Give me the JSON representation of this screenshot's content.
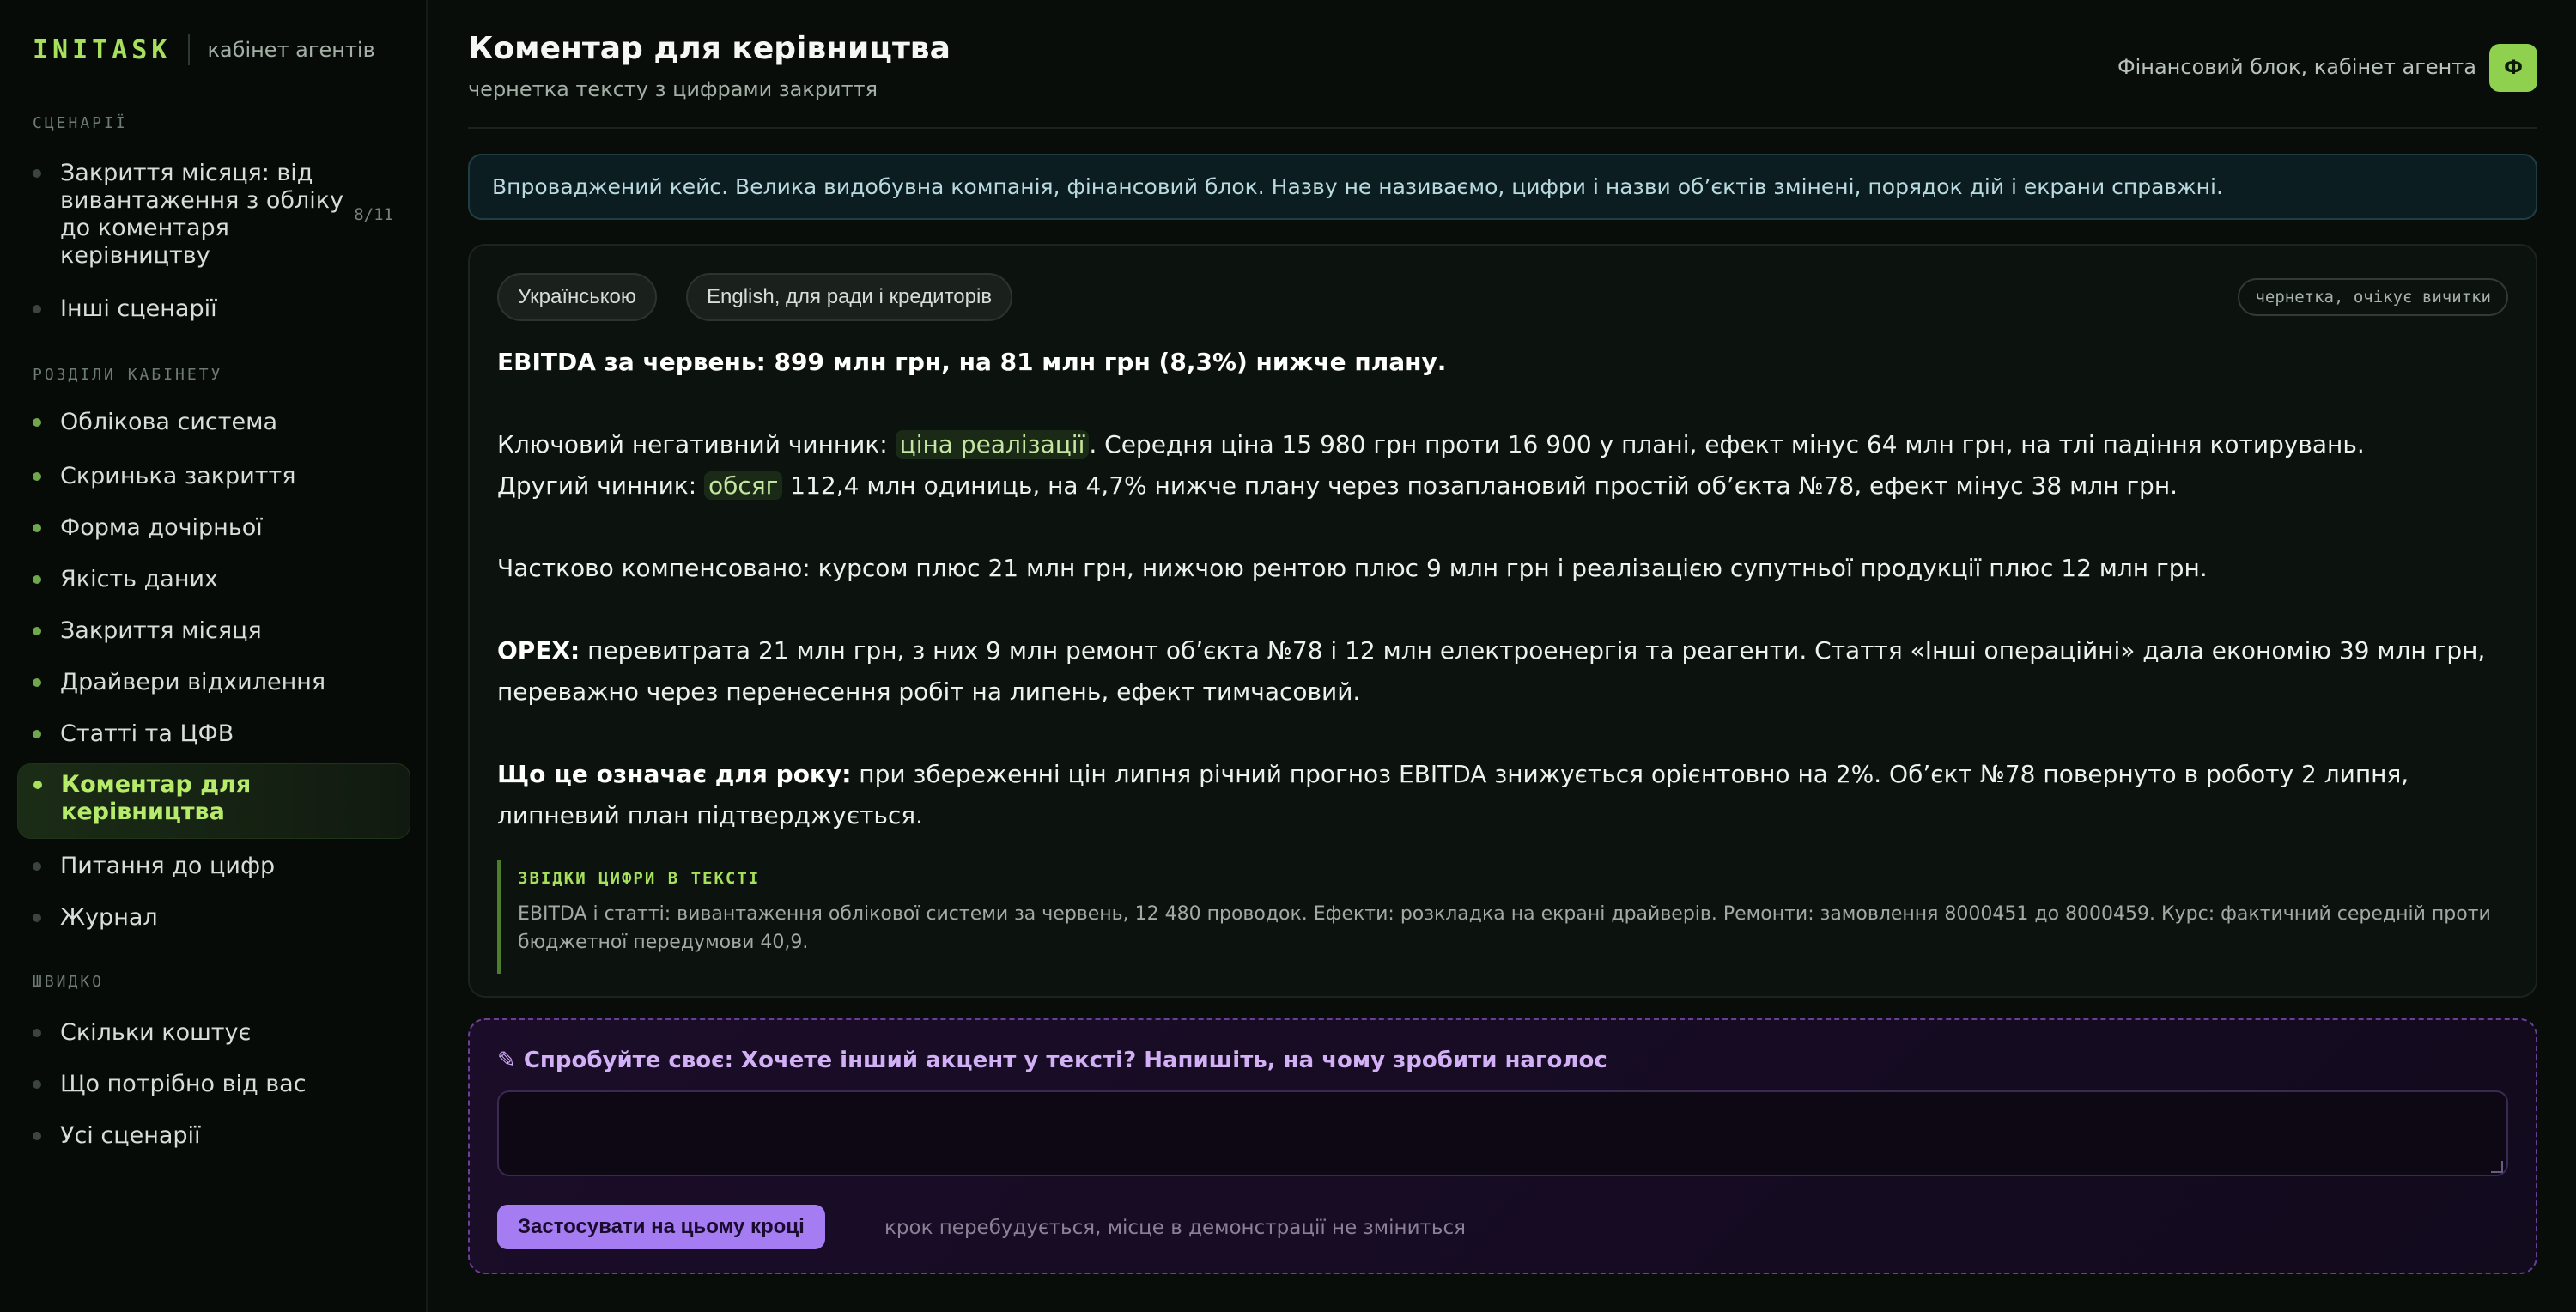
{
  "brand": {
    "logo": "INITASK",
    "subtitle": "кабінет агентів"
  },
  "sidebar": {
    "scenarios_title": "СЦЕНАРІЇ",
    "scenarios": [
      {
        "label": "Закриття місяця: від вивантаження з обліку до коментаря керівництву",
        "count": "8/11"
      },
      {
        "label": "Інші сценарії"
      }
    ],
    "sections_title": "РОЗДІЛИ КАБІНЕТУ",
    "sections": [
      {
        "label": "Облікова система"
      },
      {
        "label": "Скринька закриття"
      },
      {
        "label": "Форма дочірньої"
      },
      {
        "label": "Якість даних"
      },
      {
        "label": "Закриття місяця"
      },
      {
        "label": "Драйвери відхилення"
      },
      {
        "label": "Статті та ЦФВ"
      },
      {
        "label": "Коментар для керівництва"
      },
      {
        "label": "Питання до цифр"
      },
      {
        "label": "Журнал"
      }
    ],
    "quick_title": "ШВИДКО",
    "quick": [
      {
        "label": "Скільки коштує"
      },
      {
        "label": "Що потрібно від вас"
      },
      {
        "label": "Усі сценарії"
      }
    ]
  },
  "header": {
    "title": "Коментар для керівництва",
    "subtitle": "чернетка тексту з цифрами закриття",
    "agent_label": "Фінансовий блок, кабінет агента",
    "avatar_letter": "Ф"
  },
  "banner": "Впроваджений кейс. Велика видобувна компанія, фінансовий блок. Назву не називаємо, цифри і назви об’єктів змінені, порядок дій і екрани справжні.",
  "draft_card": {
    "lang_tabs": [
      "Українською",
      "English, для ради і кредиторів"
    ],
    "status": "чернетка, очікує вичитки",
    "headline": "EBITDA за червень: 899 млн грн, на 81 млн грн (8,3%) нижче плану.",
    "p1_a": "Ключовий негативний чинник: ",
    "p1_hl": "ціна реалізації",
    "p1_b": ". Середня ціна 15 980 грн проти 16 900 у плані, ефект мінус 64 млн грн, на тлі падіння котирувань.",
    "p2_a": "Другий чинник: ",
    "p2_hl": "обсяг",
    "p2_b": " 112,4 млн одиниць, на 4,7% нижче плану через позаплановий простій об’єкта №78, ефект мінус 38 млн грн.",
    "p3": "Частково компенсовано: курсом плюс 21 млн грн, нижчою рентою плюс 9 млн грн і реалізацією супутньої продукції плюс 12 млн грн.",
    "opex_label": "OPEX:",
    "opex_text": " перевитрата 21 млн грн, з них 9 млн ремонт об’єкта №78 і 12 млн електроенергія та реагенти. Стаття «Інші операційні» дала економію 39 млн грн, переважно через перенесення робіт на липень, ефект тимчасовий.",
    "year_label": "Що це означає для року:",
    "year_text": " при збереженні цін липня річний прогноз EBITDA знижується орієнтовно на 2%. Об’єкт №78 повернуто в роботу 2 липня, липневий план підтверджується.",
    "sources_title": "ЗВІДКИ ЦИФРИ В ТЕКСТІ",
    "sources_text": "EBITDA і статті: вивантаження облікової системи за червень, 12 480 проводок. Ефекти: розкладка на екрані драйверів. Ремонти: замовлення 8000451 до 8000459. Курс: фактичний середній проти бюджетної передумови 40,9."
  },
  "try_box": {
    "title": "✎ Спробуйте своє: Хочете інший акцент у тексті? Напишіть, на чому зробити наголос",
    "input_value": "",
    "apply_label": "Застосувати на цьому кроці",
    "apply_note": "крок перебудується, місце в демонстрації не зміниться"
  },
  "colors": {
    "accent": "#a6e05c",
    "try_accent": "#a67cf2",
    "banner_bg": "#0b1d21"
  }
}
